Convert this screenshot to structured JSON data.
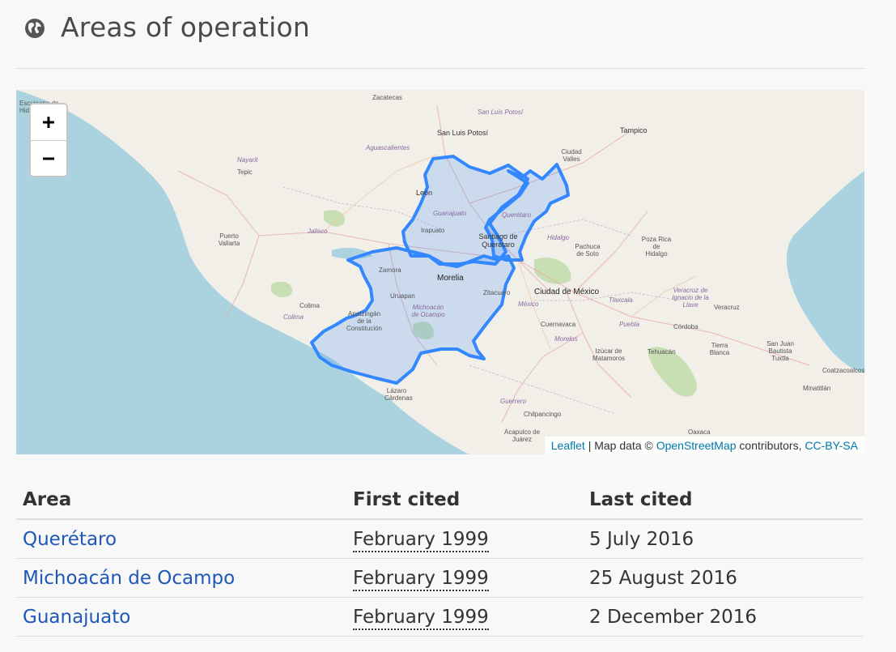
{
  "header": {
    "title": "Areas of operation",
    "icon": "globe-icon"
  },
  "map": {
    "zoom_in_label": "+",
    "zoom_out_label": "−",
    "attribution": {
      "leaflet": "Leaflet",
      "separator": " | Map data © ",
      "osm": "OpenStreetMap",
      "contributors": " contributors, ",
      "license": "CC-BY-SA"
    },
    "highlight_color": "#3388ff",
    "labels": {
      "zacatecas": "Zacatecas",
      "san_luis_potosi_state": "San Luis Potosí",
      "san_luis_potosi": "San Luis Potosí",
      "tampico": "Tampico",
      "escuinapa": "Escuinapa de Hidalgo",
      "aguascalientes": "Aguascalientes",
      "ciudad_valles": "Ciudad Valles",
      "nayarit": "Nayarit",
      "tepic": "Tepic",
      "leon": "León",
      "guanajuato": "Guanajuato",
      "queretaro_state": "Querétaro",
      "jalisco": "Jalisco",
      "irapuato": "Irapuato",
      "santiago": "Santiago de Querétaro",
      "hidalgo": "Hidalgo",
      "puerto_vallarta": "Puerto Vallarta",
      "pachuca": "Pachuca de Soto",
      "poza_rica": "Poza Rica de Hidalgo",
      "zamora": "Zamora",
      "morelia": "Morelia",
      "zitacuaro": "Zitacuaro",
      "ciudad_mexico": "Ciudad de México",
      "uruapan": "Uruapan",
      "michoacan": "Michoacán de Ocampo",
      "veracruz_state": "Veracruz de Ignacio de la Llave",
      "veracruz": "Veracruz",
      "colima": "Colima",
      "colima_state": "Colima",
      "apatzingan": "Apatzingán de la Constitución",
      "mexico": "México",
      "tlaxcala": "Tlaxcala",
      "cuernavaca": "Cuernavaca",
      "puebla": "Puebla",
      "cordoba": "Córdoba",
      "morelos": "Morelos",
      "izucar": "Izúcar de Matamoros",
      "tehuacan": "Tehuacán",
      "tierra_blanca": "Tierra Blanca",
      "san_juan": "San Juan Bautista Tuxtla",
      "coatzacoalcos": "Coatzacoalcos",
      "minatitlan": "Minatitlán",
      "lazaro": "Lázaro Cárdenas",
      "guerrero": "Guerrero",
      "chilpancingo": "Chilpancingo",
      "acapulco": "Acapulco de Juárez",
      "oaxaca": "Oaxaca"
    }
  },
  "table": {
    "headers": [
      "Area",
      "First cited",
      "Last cited"
    ],
    "rows": [
      {
        "area": "Querétaro",
        "first": "February 1999",
        "last": "5 July 2016"
      },
      {
        "area": "Michoacán de Ocampo",
        "first": "February 1999",
        "last": "25 August 2016"
      },
      {
        "area": "Guanajuato",
        "first": "February 1999",
        "last": "2 December 2016"
      }
    ]
  }
}
